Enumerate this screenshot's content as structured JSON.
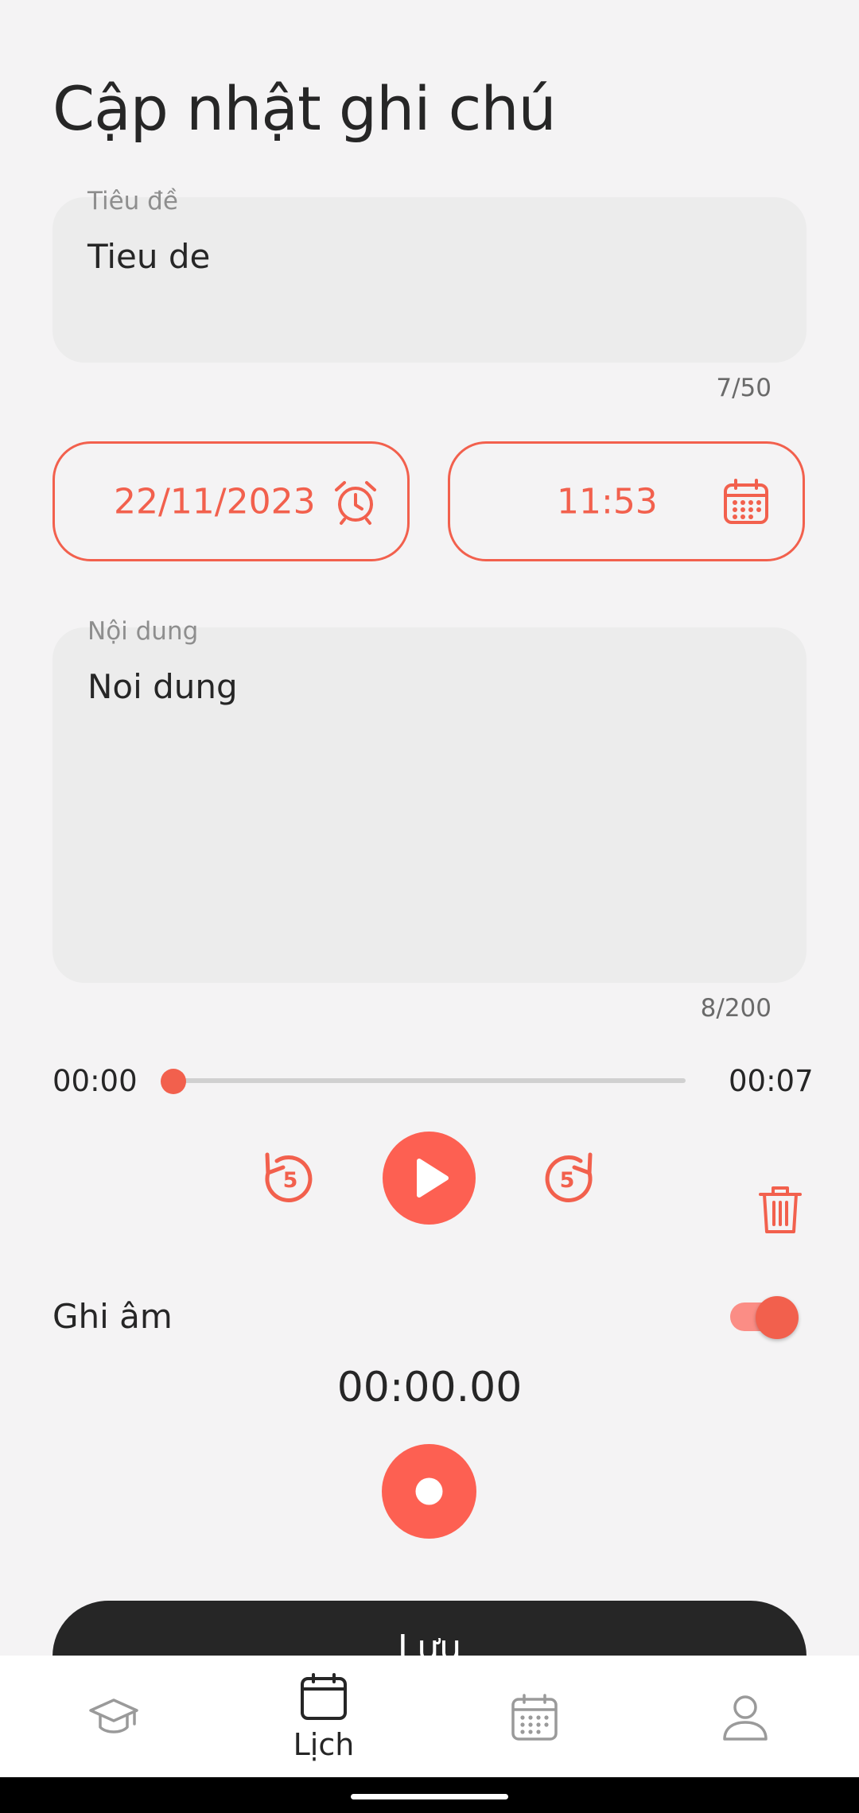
{
  "page": {
    "title": "Cập nhật ghi chú"
  },
  "title_field": {
    "label": "Tiêu đề",
    "value": "Tieu de",
    "counter": "7/50"
  },
  "datetime": {
    "date": "22/11/2023",
    "time": "11:53"
  },
  "content_field": {
    "label": "Nội dung",
    "value": "Noi dung",
    "counter": "8/200"
  },
  "player": {
    "current_time": "00:00",
    "total_time": "00:07",
    "progress": 0,
    "skip_seconds": "5"
  },
  "recording": {
    "label": "Ghi âm",
    "enabled": true,
    "timer": "00:00.00"
  },
  "actions": {
    "save_label": "Lưu"
  },
  "bottom_nav": {
    "items": [
      {
        "icon": "graduation-cap-icon",
        "label": ""
      },
      {
        "icon": "calendar-icon",
        "label": "Lịch",
        "active": true
      },
      {
        "icon": "calendar-grid-icon",
        "label": ""
      },
      {
        "icon": "person-icon",
        "label": ""
      }
    ]
  },
  "colors": {
    "accent": "#f2604d",
    "accent_light": "#fb8d85",
    "dark": "#262626",
    "background": "#f4f3f4",
    "field": "#ececec"
  }
}
